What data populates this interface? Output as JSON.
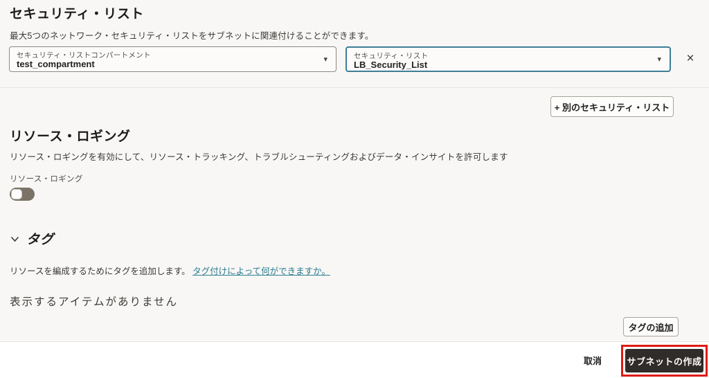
{
  "security_list": {
    "title": "セキュリティ・リスト",
    "description": "最大5つのネットワーク・セキュリティ・リストをサブネットに関連付けることができます。",
    "compartment_select": {
      "label": "セキュリティ・リストコンパートメント",
      "value": "test_compartment"
    },
    "list_select": {
      "label": "セキュリティ・リスト",
      "value": "LB_Security_List"
    },
    "add_another_button": "+ 別のセキュリティ・リスト"
  },
  "resource_logging": {
    "title": "リソース・ロギング",
    "description": "リソース・ロギングを有効にして、リソース・トラッキング、トラブルシューティングおよびデータ・インサイトを許可します",
    "toggle_label": "リソース・ロギング",
    "toggle_state": "off"
  },
  "tags": {
    "title": "タグ",
    "description": "リソースを編成するためにタグを追加します。",
    "link_text": "タグ付けによって何ができますか。",
    "empty_message": "表示するアイテムがありません",
    "add_tag_button": "タグの追加"
  },
  "footer": {
    "cancel_label": "取消",
    "create_button_label": "サブネットの作成"
  },
  "icons": {
    "caret_down": "▾",
    "close": "×"
  },
  "colors": {
    "content_background": "#f8f7f5",
    "focused_select_border": "#3d7d98",
    "link": "#2c7c91",
    "toggle_track_off": "#7b7366",
    "primary_button_bg": "#2f2c29",
    "annotation_red": "#de1a12"
  }
}
